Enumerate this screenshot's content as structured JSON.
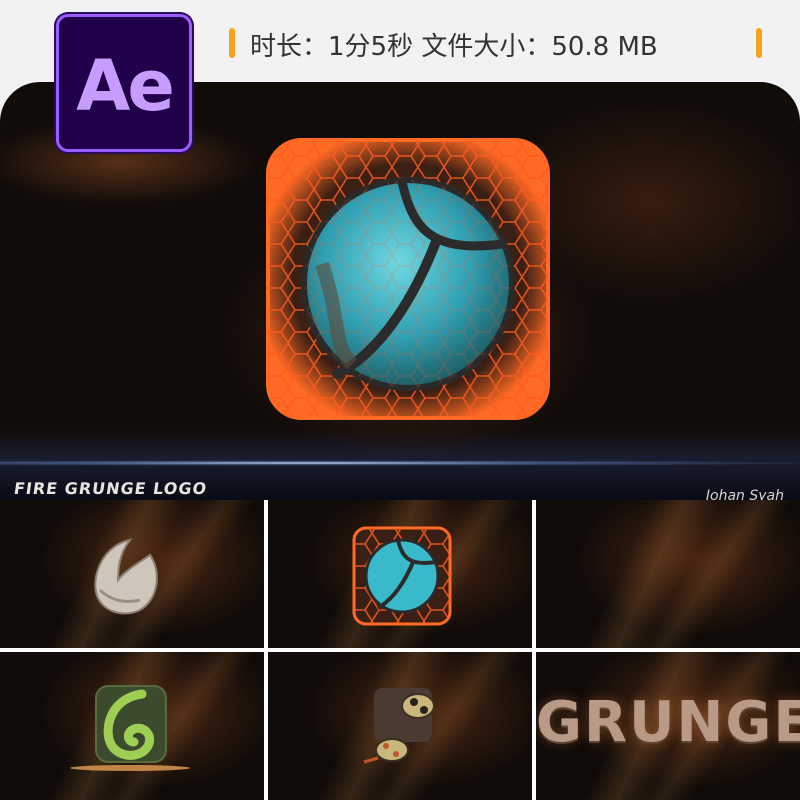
{
  "header": {
    "app_badge": "Ae",
    "info_text": "时长：1分5秒  文件大小：50.8 MB"
  },
  "hero": {
    "title": "FIRE GRUNGE LOGO",
    "author": "Johan Syah"
  },
  "tiles": {
    "grunge_word": "GRUNGE"
  },
  "colors": {
    "accent": "#f7a21b",
    "ae_purple": "#9b5cff",
    "ae_bg": "#21004a",
    "lava": "#ff5a1e",
    "teal": "#39b9c9"
  }
}
